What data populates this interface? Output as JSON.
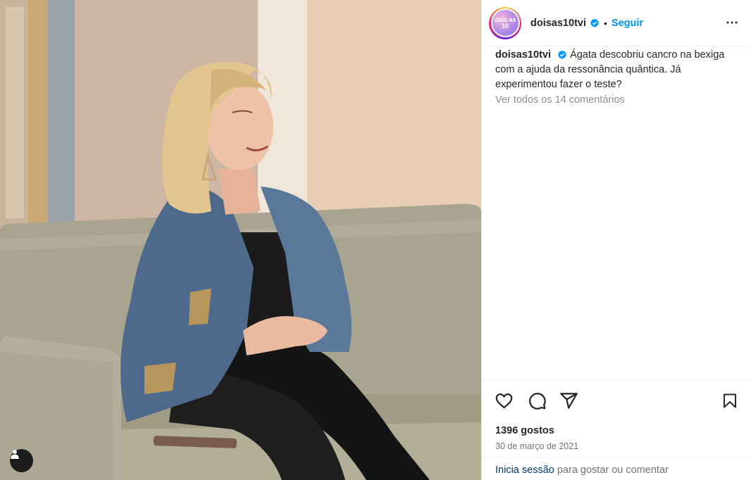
{
  "post": {
    "image_alt": "Mulher de cabelo loiro com casaco de ganga sentada num sofá",
    "username": "doisas10tvi",
    "avatar_text": "dois as 10",
    "follow_label": "Seguir",
    "dot": "•",
    "caption_text": "Ágata descobriu cancro na bexiga com a ajuda da ressonância quântica. Já experimentou fazer o teste?",
    "comments_link": "Ver todos os 14 comentários",
    "likes": "1396 gostos",
    "date": "30 de março de 2021",
    "footer_login": "Inicia sessão",
    "footer_rest": " para gostar ou comentar"
  },
  "icons": {
    "verified": "verified-badge-icon",
    "more": "more-options-icon",
    "like": "heart-icon",
    "comment": "comment-icon",
    "share": "share-icon",
    "save": "bookmark-icon",
    "tag": "user-tag-icon"
  },
  "colors": {
    "link_blue": "#0095f6",
    "secondary_text": "#8e8e8e",
    "primary_text": "#262626",
    "border": "#efefef"
  }
}
